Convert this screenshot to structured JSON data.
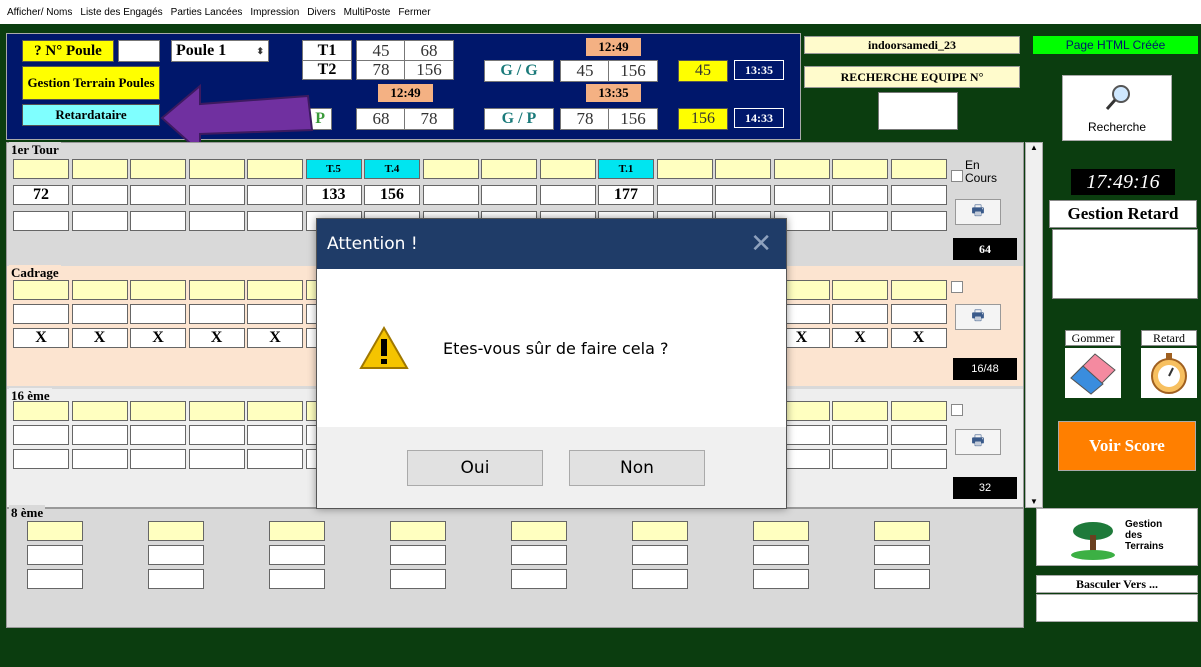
{
  "menu": [
    "Afficher/ Noms",
    "Liste des Engagés",
    "Parties Lancées",
    "Impression",
    "Divers",
    "MultiPoste",
    "Fermer"
  ],
  "top": {
    "poule_label": "? N° Poule",
    "poule_select": "Poule 1",
    "gestion_terrain": "Gestion Terrain Poules",
    "retardataire": "Retardataire",
    "t1": "T1",
    "t2": "T2",
    "t1_a": "45",
    "t1_b": "68",
    "t2_a": "78",
    "t2_b": "156",
    "time_1249_a": "12:49",
    "time_1249_b": "12:49",
    "gg": "G / G",
    "gg_a": "45",
    "gg_b": "156",
    "gg_c": "45",
    "gg_time": "13:35",
    "time_1335": "13:35",
    "p_partial": "P",
    "p_a": "68",
    "p_b": "78",
    "gp": "G / P",
    "gp_a": "78",
    "gp_b": "156",
    "gp_c": "156",
    "gp_time": "14:33",
    "indoor": "indoorsamedi_23",
    "recherche_equipe": "RECHERCHE EQUIPE N°"
  },
  "right": {
    "page_html": "Page HTML Créée",
    "recherche": "Recherche",
    "clock": "17:49:16",
    "gestion_retard": "Gestion Retard",
    "gommer": "Gommer",
    "retard": "Retard",
    "voir_score": "Voir Score",
    "gestion_terrains": "Gestion des Terrains",
    "basculer": "Basculer Vers ..."
  },
  "sections": {
    "s1": {
      "label": "1er Tour",
      "t5": "T.5",
      "t4": "T.4",
      "t1": "T.1",
      "v1": "72",
      "v2": "133",
      "v3": "156",
      "v4": "177",
      "en_cours": "En Cours",
      "count": "64"
    },
    "s2": {
      "label": "Cadrage",
      "x": "X",
      "count": "16/48"
    },
    "s3": {
      "label": "16 ème",
      "count": "32"
    },
    "s4": {
      "label": "8 ème"
    }
  },
  "dialog": {
    "title": "Attention !",
    "message": "Etes-vous sûr de faire cela ?",
    "yes": "Oui",
    "no": "Non"
  }
}
